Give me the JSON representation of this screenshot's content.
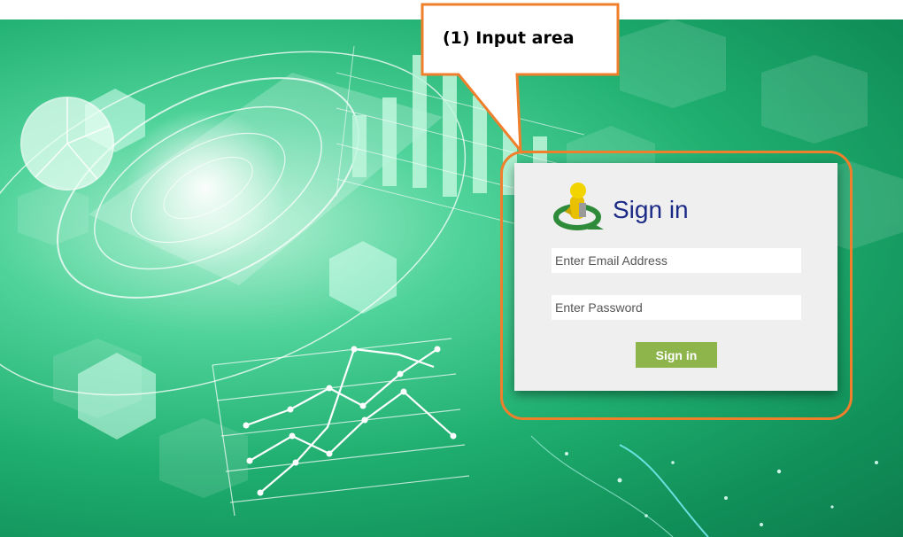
{
  "callout": {
    "label": "(1) Input area"
  },
  "signin": {
    "title": "Sign in",
    "email_placeholder": "Enter Email Address",
    "password_placeholder": "Enter Password",
    "button_label": "Sign in"
  },
  "colors": {
    "accent_orange": "#f07f2c",
    "title_blue": "#1b2a86",
    "button_green": "#8db54c",
    "card_bg": "#efefef"
  }
}
